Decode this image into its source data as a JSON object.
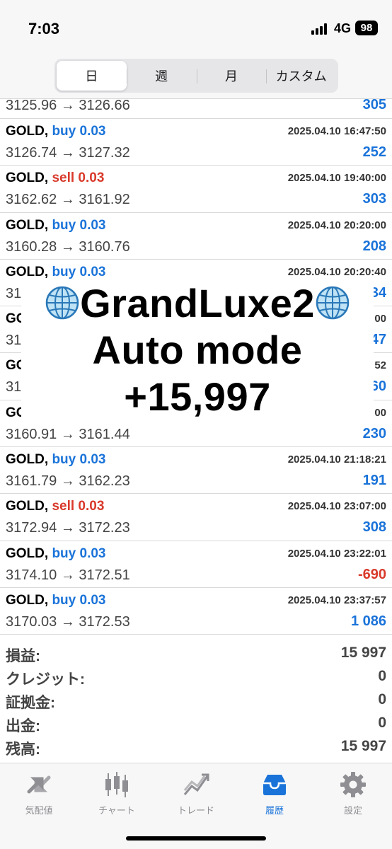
{
  "status_bar": {
    "time": "7:03",
    "network": "4G",
    "battery": "98"
  },
  "period_tabs": [
    {
      "label": "日",
      "active": true
    },
    {
      "label": "週",
      "active": false
    },
    {
      "label": "月",
      "active": false
    },
    {
      "label": "カスタム",
      "active": false
    }
  ],
  "deals": [
    {
      "symbol": "",
      "side": "",
      "volume": "",
      "datetime": "",
      "prices": "3125.96 → 3126.66",
      "profit": "305"
    },
    {
      "symbol": "GOLD,",
      "side": "buy",
      "volume": "buy 0.03",
      "datetime": "2025.04.10 16:47:50",
      "prices": "3126.74 → 3127.32",
      "profit": "252"
    },
    {
      "symbol": "GOLD,",
      "side": "sell",
      "volume": "sell 0.03",
      "datetime": "2025.04.10 19:40:00",
      "prices": "3162.62 → 3161.92",
      "profit": "303"
    },
    {
      "symbol": "GOLD,",
      "side": "buy",
      "volume": "buy 0.03",
      "datetime": "2025.04.10 20:20:00",
      "prices": "3160.28 → 3160.76",
      "profit": "208"
    },
    {
      "symbol": "GOLD,",
      "side": "buy",
      "volume": "buy 0.03",
      "datetime": "2025.04.10 20:20:40",
      "prices": "31",
      "profit": "34"
    },
    {
      "symbol": "GO",
      "side": "",
      "volume": "",
      "datetime": "00",
      "prices": "31",
      "profit": "47"
    },
    {
      "symbol": "GO",
      "side": "",
      "volume": "",
      "datetime": "52",
      "prices": "31",
      "profit": "60"
    },
    {
      "symbol": "GO",
      "side": "",
      "volume": "",
      "datetime": "00",
      "prices": "3160.91 → 3161.44",
      "profit": "230"
    },
    {
      "symbol": "GOLD,",
      "side": "buy",
      "volume": "buy 0.03",
      "datetime": "2025.04.10 21:18:21",
      "prices": "3161.79 → 3162.23",
      "profit": "191"
    },
    {
      "symbol": "GOLD,",
      "side": "sell",
      "volume": "sell 0.03",
      "datetime": "2025.04.10 23:07:00",
      "prices": "3172.94 → 3172.23",
      "profit": "308"
    },
    {
      "symbol": "GOLD,",
      "side": "buy",
      "volume": "buy 0.03",
      "datetime": "2025.04.10 23:22:01",
      "prices": "3174.10 → 3172.51",
      "profit": "-690"
    },
    {
      "symbol": "GOLD,",
      "side": "buy",
      "volume": "buy 0.03",
      "datetime": "2025.04.10 23:37:57",
      "prices": "3170.03 → 3172.53",
      "profit": "1 086"
    }
  ],
  "summary": [
    {
      "label": "損益:",
      "value": "15 997"
    },
    {
      "label": "クレジット:",
      "value": "0"
    },
    {
      "label": "証拠金:",
      "value": "0"
    },
    {
      "label": "出金:",
      "value": "0"
    },
    {
      "label": "残高:",
      "value": "15 997"
    }
  ],
  "overlay": {
    "line1": "GrandLuxe2",
    "line2": "Auto mode",
    "line3": "+15,997"
  },
  "tab_bar": [
    {
      "label": "気配値",
      "icon": "quotes-icon",
      "active": false
    },
    {
      "label": "チャート",
      "icon": "chart-icon",
      "active": false
    },
    {
      "label": "トレード",
      "icon": "trade-icon",
      "active": false
    },
    {
      "label": "履歴",
      "icon": "history-icon",
      "active": true
    },
    {
      "label": "設定",
      "icon": "settings-icon",
      "active": false
    }
  ],
  "colors": {
    "buy": "#1a73d9",
    "sell": "#d93a2b",
    "active_tab": "#1a73d9",
    "inactive_tab": "#8e8e93"
  }
}
